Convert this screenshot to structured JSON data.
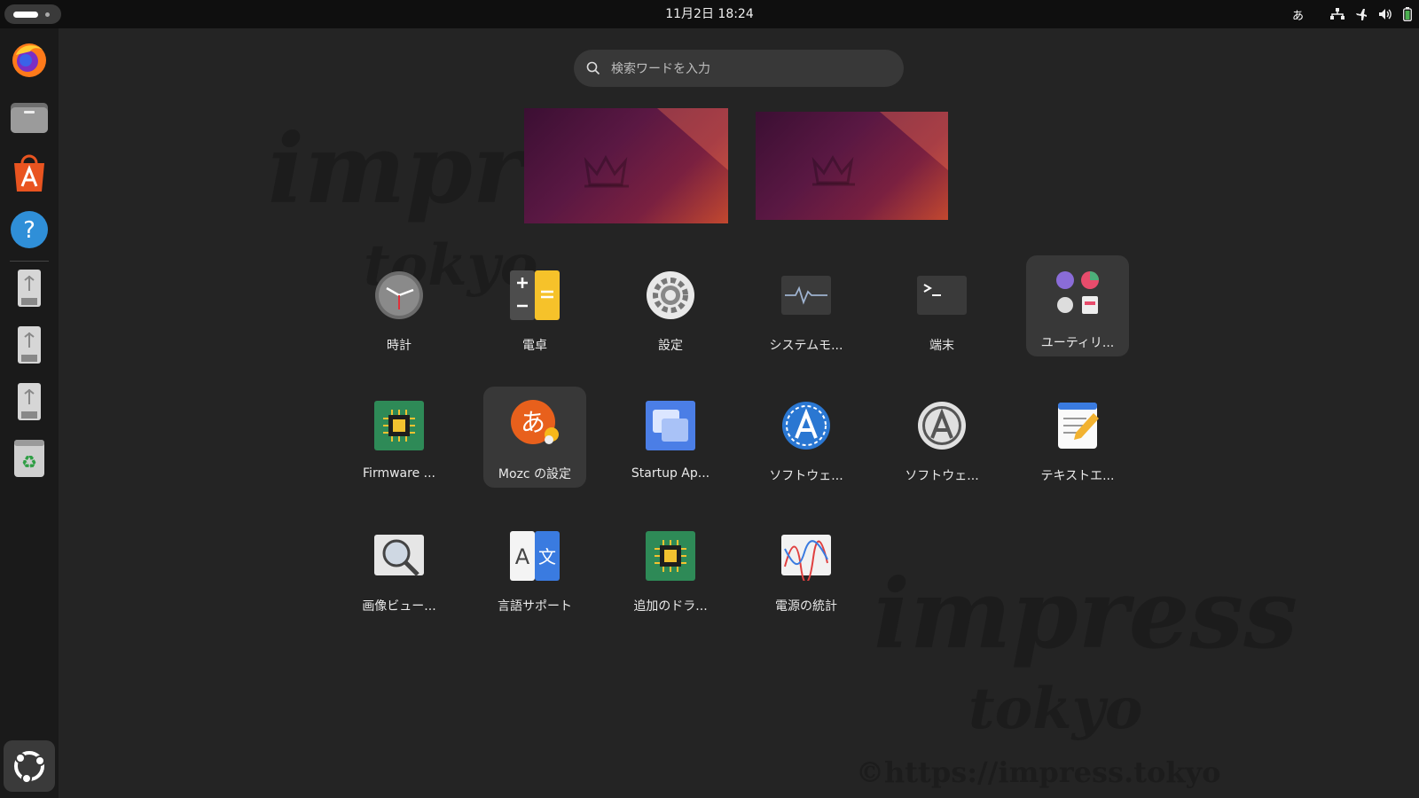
{
  "topbar": {
    "datetime": "11月2日  18:24",
    "input_method": "あ"
  },
  "search": {
    "placeholder": "検索ワードを入力"
  },
  "watermark": {
    "line1": "impress",
    "line2": "tokyo",
    "url": "©https://impress.tokyo"
  },
  "apps": [
    {
      "label": "時計",
      "icon": "clock-icon"
    },
    {
      "label": "電卓",
      "icon": "calculator-icon"
    },
    {
      "label": "設定",
      "icon": "settings-icon"
    },
    {
      "label": "システムモ...",
      "icon": "system-monitor-icon"
    },
    {
      "label": "端末",
      "icon": "terminal-icon"
    },
    {
      "label": "ユーティリ...",
      "icon": "utilities-folder-icon"
    },
    {
      "label": "Firmware ...",
      "icon": "firmware-icon"
    },
    {
      "label": "Mozc の設定",
      "icon": "mozc-icon"
    },
    {
      "label": "Startup Ap...",
      "icon": "startup-apps-icon"
    },
    {
      "label": "ソフトウェ...",
      "icon": "software-updater-icon"
    },
    {
      "label": "ソフトウェ...",
      "icon": "software-properties-icon"
    },
    {
      "label": "テキストエ...",
      "icon": "text-editor-icon"
    },
    {
      "label": "画像ビュー...",
      "icon": "image-viewer-icon"
    },
    {
      "label": "言語サポート",
      "icon": "language-support-icon"
    },
    {
      "label": "追加のドラ...",
      "icon": "additional-drivers-icon"
    },
    {
      "label": "電源の統計",
      "icon": "power-statistics-icon"
    }
  ],
  "dock": [
    "firefox-icon",
    "files-icon",
    "app-center-icon",
    "help-icon",
    "usb-drive-icon",
    "usb-drive-icon",
    "usb-drive-icon",
    "trash-icon",
    "show-apps-icon"
  ],
  "colors": {
    "background": "#242424",
    "topbar": "#0f0f0f",
    "dock": "#1a1a1a",
    "accent": "#e95420"
  }
}
